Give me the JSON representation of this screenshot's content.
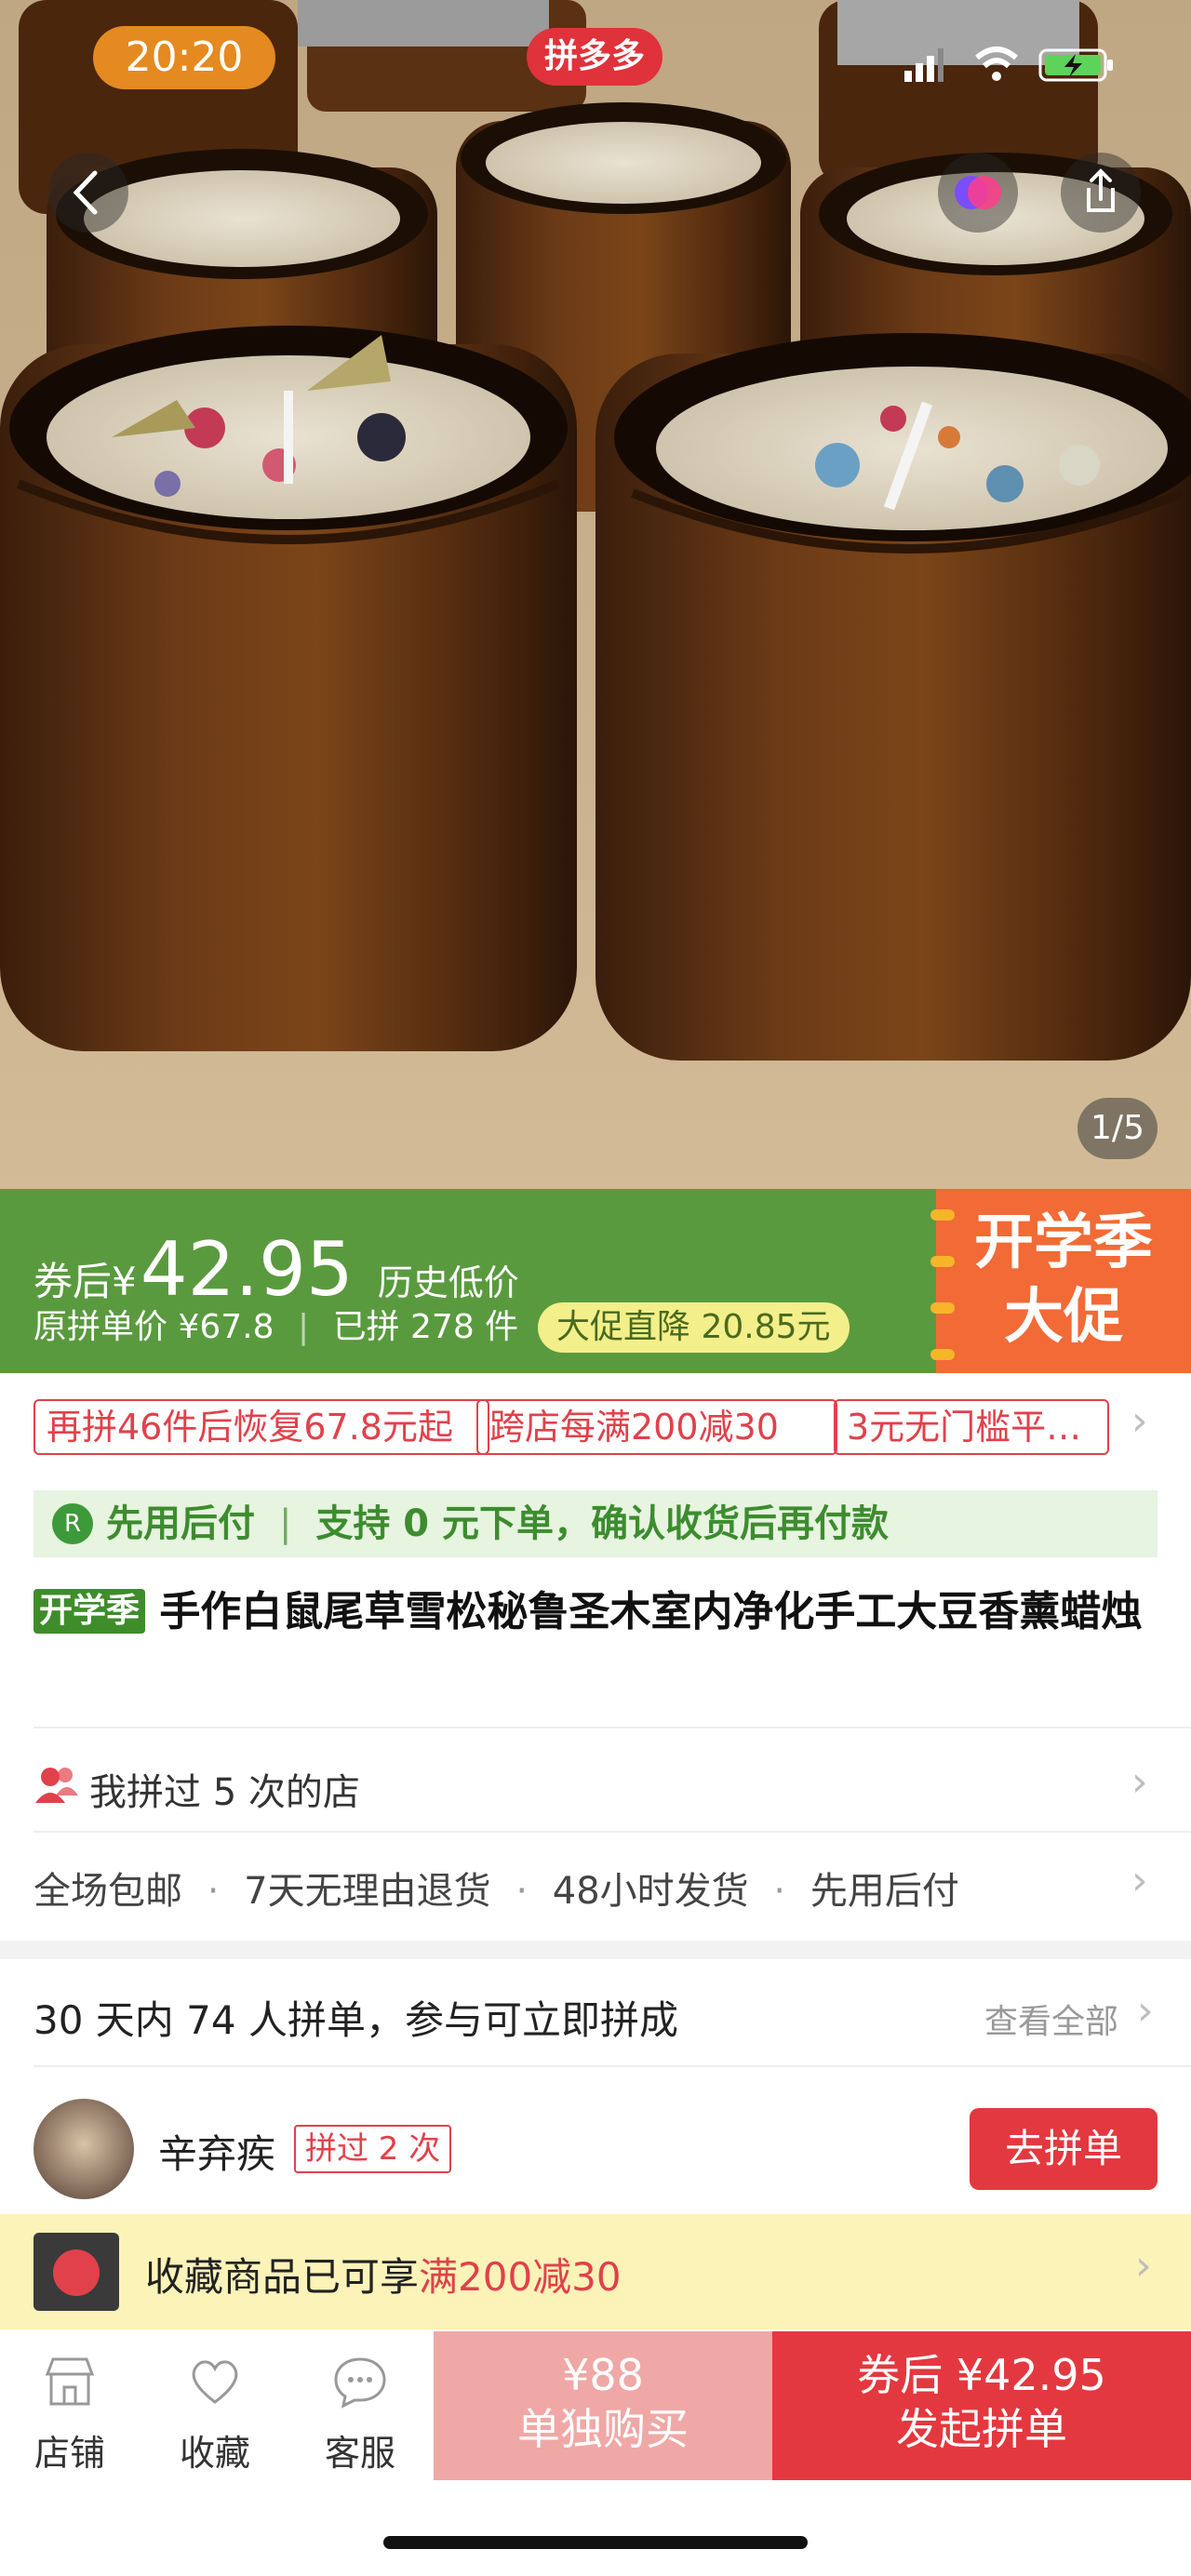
{
  "status_bar": {
    "time": "20:20",
    "app_badge": "拼多多"
  },
  "gallery": {
    "counter": "1/5"
  },
  "price": {
    "coupon_prefix": "券后",
    "currency": "¥",
    "amount": "42.95",
    "history_low": "历史低价",
    "original_label": "原拼单价 ¥67.8",
    "sold_label": "已拼 278 件",
    "discount_badge": "大促直降 20.85元",
    "promo_line1": "开学季",
    "promo_line2": "大促"
  },
  "coupons": [
    "再拼46件后恢复67.8元起",
    "跨店每满200减30",
    "3元无门槛平…"
  ],
  "pay_later": {
    "title": "先用后付",
    "desc": "支持 0 元下单，确认收货后再付款"
  },
  "product": {
    "badge": "开学季",
    "title": "手作白鼠尾草雪松秘鲁圣木室内净化手工大豆香薰蜡烛"
  },
  "store_history": "我拼过 5 次的店",
  "services": [
    "全场包邮",
    "7天无理由退货",
    "48小时发货",
    "先用后付"
  ],
  "group": {
    "summary": "30 天内 74 人拼单，参与可立即拼成",
    "view_all": "查看全部",
    "member_name": "辛弃疾",
    "member_badge": "拼过 2 次",
    "join_button": "去拼单"
  },
  "favorite_banner": {
    "text_prefix": "收藏商品已可享",
    "text_highlight": "满200减30"
  },
  "bottom_bar": {
    "tabs": [
      {
        "label": "店铺",
        "icon": "store-icon"
      },
      {
        "label": "收藏",
        "icon": "heart-icon"
      },
      {
        "label": "客服",
        "icon": "chat-icon"
      }
    ],
    "solo_price": "¥88",
    "solo_label": "单独购买",
    "group_price": "券后 ¥42.95",
    "group_label": "发起拼单"
  },
  "colors": {
    "price_banner": "#5a9a3f",
    "promo": "#f26a36",
    "brand_red": "#e1414b",
    "group_button": "#e3383f",
    "solo_button": "#efa8a6"
  }
}
